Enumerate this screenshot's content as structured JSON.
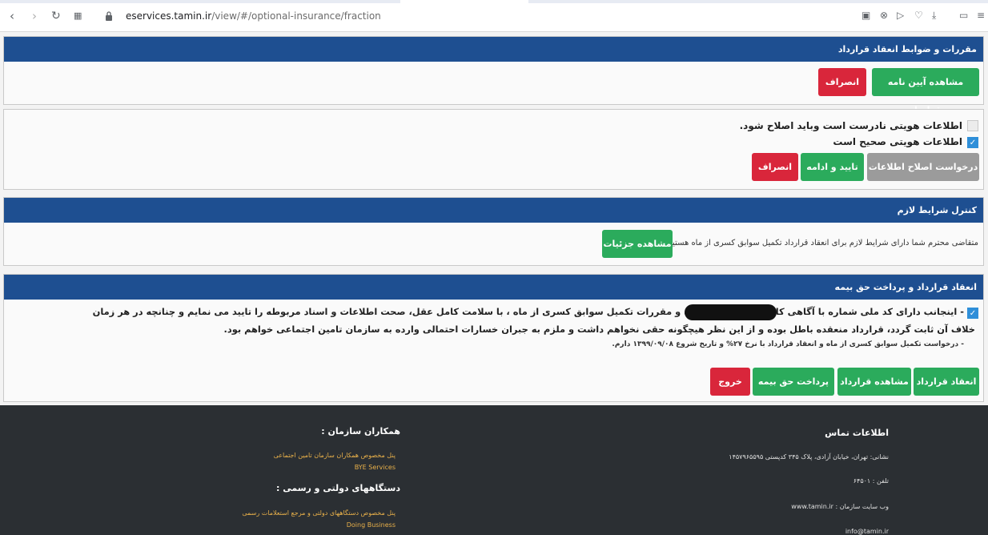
{
  "browser": {
    "url_domain": "eservices.tamin.ir",
    "url_path": "/view/#/optional-insurance/fraction",
    "back_icon": "chevron-left-icon",
    "forward_icon": "chevron-right-icon",
    "reload_icon": "reload-icon",
    "apps_icon": "apps-grid-icon",
    "lock_icon": "lock-icon"
  },
  "section_rules": {
    "title": "مقررات و ضوابط انعقاد قرارداد",
    "view_contract_rules_label": "مشاهده آیین نامه قرارداد",
    "cancel_label": "انصراف"
  },
  "section_identity": {
    "incorrect_label": "اطلاعات هویتی نادرست است وباید اصلاح شود.",
    "correct_label": "اطلاعات هویتی صحیح است",
    "correct_checked": true,
    "request_fix_label": "درخواست اصلاح اطلاعات",
    "confirm_label": "تایید و ادامه",
    "cancel_label": "انصراف"
  },
  "section_conditions": {
    "title": "کنترل شرایط لازم",
    "message": "متقاضی محترم شما دارای شرایط لازم برای انعقاد قرارداد تکمیل سوابق کسری از ماه هستید.",
    "details_label": "مشاهده جزئیات"
  },
  "section_contract": {
    "title": "انعقاد قرارداد و پرداخت حق بیمه",
    "declaration_line1": "- اینجانب                        دارای کد ملی شماره               با آگاهی کامل از مفاد آئین نامه و مقررات تکمیل سوابق کسری از ماه ، با سلامت کامل عقل، صحت اطلاعات و اسناد مربوطه را تایید می نمایم و چنانچه در هر زمان",
    "declaration_line2": "خلاف آن ثابت گردد، قرارداد منعقده باطل بوده و از این نظر هیچگونه حقی نخواهم داشت و ملزم به جبران خسارات احتمالی وارده به سازمان تامین اجتماعی خواهم بود.",
    "request_note": "- درخواست تکمیل سوابق کسری از ماه و انعقاد قرارداد با نرخ ۲۷% و تاریخ شروع ۱۳۹۹/۰۹/۰۸ دارم.",
    "sign_contract_label": "انعقاد قرارداد",
    "view_contract_label": "مشاهده قرارداد",
    "pay_premium_label": "پرداخت حق بیمه",
    "exit_label": "خروج"
  },
  "footer": {
    "contact_title": "اطلاعات تماس",
    "address": "نشانی: تهران، خیابان آزادی، پلاک ۳۴۵ کدپستی ۱۴۵۷۹۶۵۵۹۵",
    "phone": "تلفن : ۶۴۵۰۱",
    "website": "وب سایت سازمان : www.tamin.ir",
    "partners_title": "همکاران سازمان :",
    "partners_desc": "پنل مخصوص همکاران سازمان تامین اجتماعی",
    "partners_link": "BYE Services",
    "gov_title": "دستگاههای دولتی و رسمی :",
    "gov_desc": "پنل مخصوص دستگاههای دولتی و مرجع استعلامات رسمی",
    "gov_link": "Doing Business"
  }
}
